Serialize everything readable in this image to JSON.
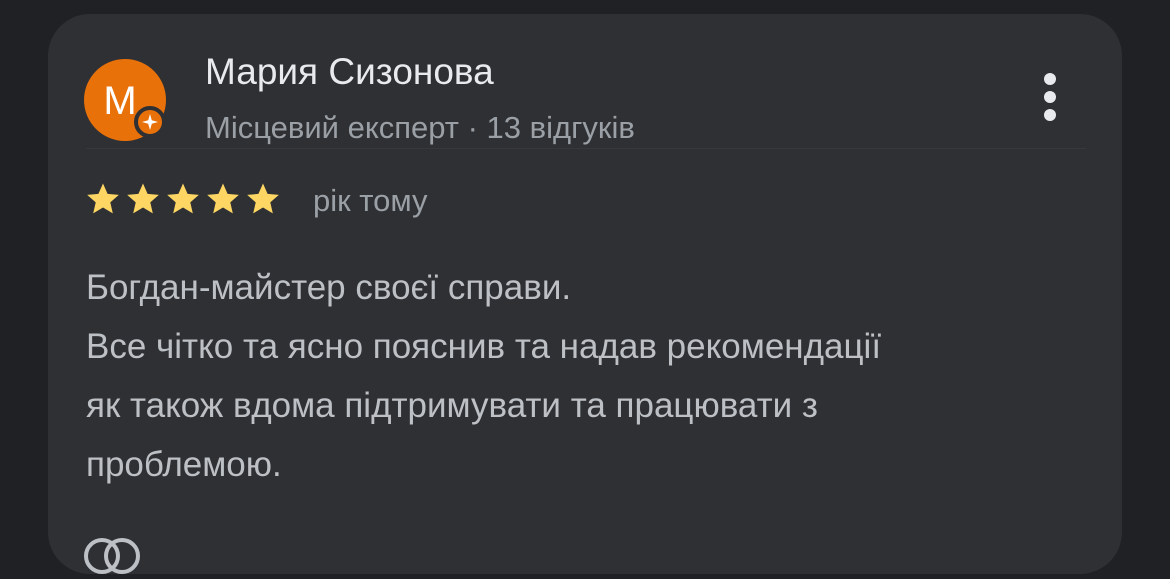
{
  "review": {
    "author": {
      "initial": "M",
      "name": "Мария Сизонова",
      "meta": "Місцевий експерт · 13 відгуків",
      "avatar_color": "#e8710a"
    },
    "rating": 5,
    "rating_max": 5,
    "date": "рік тому",
    "text_lines": [
      "Богдан-майстер своєї справи.",
      "Все чітко та ясно пояснив та надав рекомендації",
      "як також вдома підтримувати та працювати з",
      "проблемою."
    ],
    "icons": {
      "more": "more-vert-icon",
      "badge": "local-guide-star-icon",
      "reaction": "reaction-icon"
    }
  },
  "colors": {
    "background": "#202124",
    "card": "#2f3033",
    "star": "#fdd663",
    "name": "#e8eaed",
    "secondary": "#9aa0a6",
    "body_text": "#bdc1c6"
  }
}
